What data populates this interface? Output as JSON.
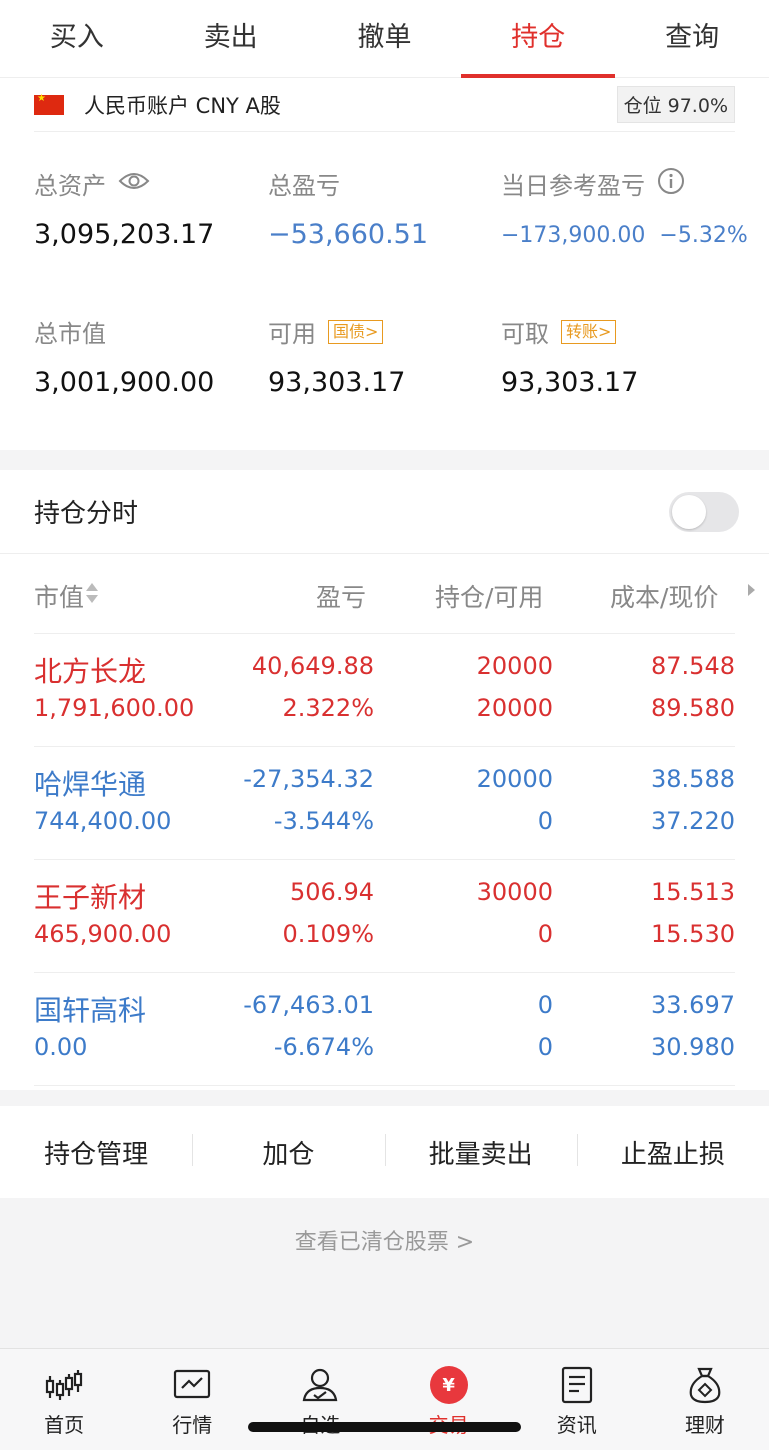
{
  "tabs": [
    {
      "label": "买入",
      "active": false
    },
    {
      "label": "卖出",
      "active": false
    },
    {
      "label": "撤单",
      "active": false
    },
    {
      "label": "持仓",
      "active": true
    },
    {
      "label": "查询",
      "active": false
    }
  ],
  "account": {
    "name": "人民币账户 CNY A股",
    "position_ratio": "仓位 97.0%",
    "total_assets_label": "总资产",
    "total_assets": "3,095,203.17",
    "total_pl_label": "总盈亏",
    "total_pl": "−53,660.51",
    "daily_pl_label": "当日参考盈亏",
    "daily_pl": "−173,900.00",
    "daily_pl_pct": "−5.32%",
    "market_value_label": "总市值",
    "market_value": "3,001,900.00",
    "available_label": "可用",
    "available_tag": "国债>",
    "available": "93,303.17",
    "withdrawable_label": "可取",
    "withdrawable_tag": "转账>",
    "withdrawable": "93,303.17"
  },
  "positions": {
    "intraday_label": "持仓分时",
    "intraday_enabled": false,
    "headers": {
      "market_value": "市值",
      "pl": "盈亏",
      "holding": "持仓/可用",
      "cost": "成本/现价"
    },
    "rows": [
      {
        "name": "北方长龙",
        "market_value": "1,791,600.00",
        "pl": "40,649.88",
        "pl_pct": "2.322%",
        "holding": "20000",
        "available": "20000",
        "cost": "87.548",
        "price": "89.580",
        "color": "red"
      },
      {
        "name": "哈焊华通",
        "market_value": "744,400.00",
        "pl": "-27,354.32",
        "pl_pct": "-3.544%",
        "holding": "20000",
        "available": "0",
        "cost": "38.588",
        "price": "37.220",
        "color": "blue"
      },
      {
        "name": "王子新材",
        "market_value": "465,900.00",
        "pl": "506.94",
        "pl_pct": "0.109%",
        "holding": "30000",
        "available": "0",
        "cost": "15.513",
        "price": "15.530",
        "color": "red"
      },
      {
        "name": "国轩高科",
        "market_value": "0.00",
        "pl": "-67,463.01",
        "pl_pct": "-6.674%",
        "holding": "0",
        "available": "0",
        "cost": "33.697",
        "price": "30.980",
        "color": "blue"
      }
    ]
  },
  "actions": [
    "持仓管理",
    "加仓",
    "批量卖出",
    "止盈止损"
  ],
  "cleared_link": "查看已清仓股票 >",
  "bottom_nav": [
    {
      "label": "首页",
      "icon": "candlestick-icon",
      "active": false
    },
    {
      "label": "行情",
      "icon": "chart-icon",
      "active": false
    },
    {
      "label": "自选",
      "icon": "user-icon",
      "active": false
    },
    {
      "label": "交易",
      "icon": "yuan-icon",
      "active": true
    },
    {
      "label": "资讯",
      "icon": "document-icon",
      "active": false
    },
    {
      "label": "理财",
      "icon": "money-bag-icon",
      "active": false
    }
  ],
  "icons": {
    "yuan_symbol": "¥"
  },
  "colors": {
    "accent": "#e0302c",
    "up": "#d93030",
    "down": "#3d7bc9",
    "tag": "#e89a20"
  }
}
